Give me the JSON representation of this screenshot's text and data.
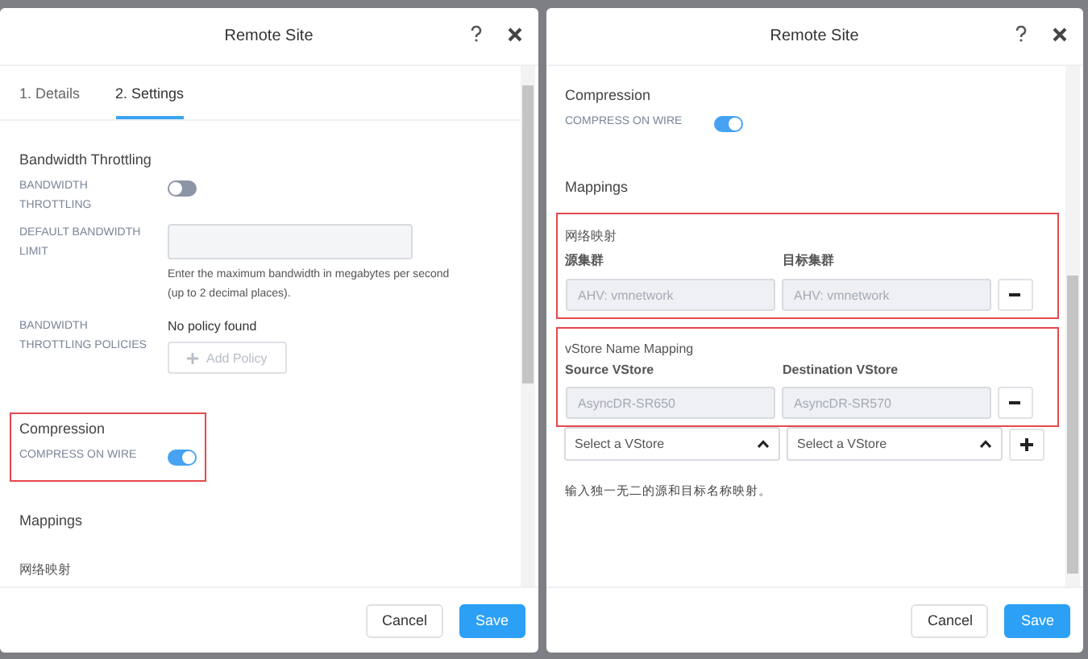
{
  "dialogs": [
    {
      "title": "Remote Site",
      "tabs": [
        {
          "label": "1. Details",
          "selected": false
        },
        {
          "label": "2. Settings",
          "selected": true
        }
      ],
      "sections": [
        {
          "title": "Bandwidth Throttling",
          "highlighted": false,
          "rows": [
            {
              "kind": "toggle",
              "label": "BANDWIDTH THROTTLING",
              "on": false
            },
            {
              "kind": "input",
              "label": "DEFAULT BANDWIDTH LIMIT",
              "help": "Enter the maximum bandwidth in megabytes per second (up to 2 decimal places)."
            },
            {
              "kind": "policies",
              "label": "BANDWIDTH THROTTLING POLICIES",
              "text": "No policy found",
              "button": "Add Policy",
              "disabled": true
            }
          ]
        },
        {
          "title": "Compression",
          "highlighted": true,
          "rows": [
            {
              "kind": "toggle",
              "label": "COMPRESS ON WIRE",
              "on": true
            }
          ]
        },
        {
          "title": "Mappings",
          "highlighted": false,
          "groups": [
            {
              "title": "网络映射",
              "highlighted": false
            }
          ]
        }
      ],
      "buttons": [
        {
          "label": "Cancel",
          "kind": "secondary"
        },
        {
          "label": "Save",
          "kind": "primary"
        }
      ]
    },
    {
      "title": "Remote Site",
      "sections": [
        {
          "title": "Compression",
          "highlighted": false,
          "rows": [
            {
              "kind": "toggle",
              "label": "COMPRESS ON WIRE",
              "on": true
            }
          ]
        },
        {
          "title": "Mappings",
          "highlighted": false,
          "groups": [
            {
              "title": "网络映射",
              "highlighted": true,
              "columns": [
                "源集群",
                "目标集群"
              ],
              "rows": [
                {
                  "source": "AHV: vmnetwork",
                  "target": "AHV: vmnetwork"
                }
              ]
            },
            {
              "title": "vStore Name Mapping",
              "highlighted": true,
              "columns": [
                "Source VStore",
                "Destination VStore"
              ],
              "rows": [
                {
                  "source": "AsyncDR-SR650",
                  "target": "AsyncDR-SR570"
                }
              ]
            }
          ],
          "new_row": {
            "source_placeholder": "Select a VStore",
            "target_placeholder": "Select a VStore"
          },
          "note": "输入独一无二的源和目标名称映射。"
        }
      ],
      "buttons": [
        {
          "label": "Cancel",
          "kind": "secondary"
        },
        {
          "label": "Save",
          "kind": "primary"
        }
      ]
    }
  ]
}
